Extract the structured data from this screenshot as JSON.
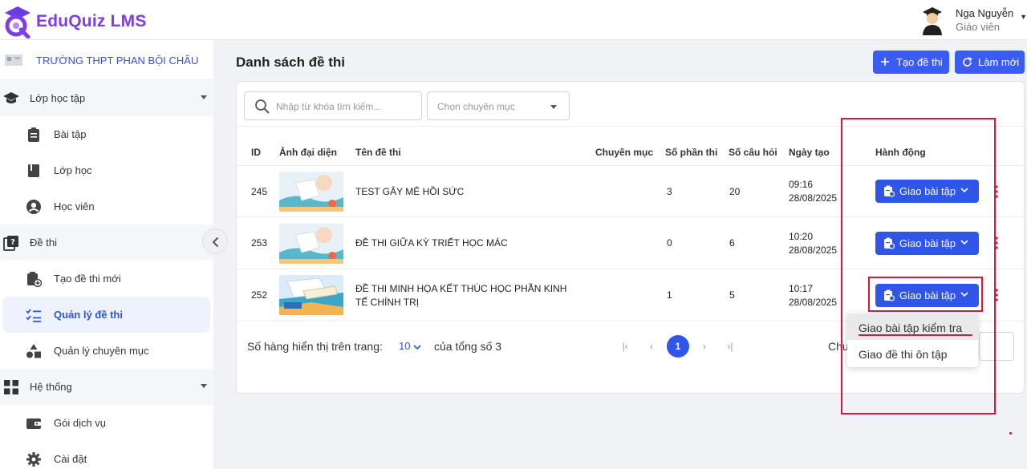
{
  "header": {
    "brand": "EduQuiz LMS",
    "user_name": "Nga Nguyễn",
    "user_role": "Giáo viên"
  },
  "sidebar": {
    "school": "TRƯỜNG THPT PHAN BỘI CHÂU",
    "groups": [
      {
        "label": "Lớp học tập",
        "icon": "graduation-cap-icon",
        "items": [
          {
            "label": "Bài tập",
            "icon": "clipboard-icon"
          },
          {
            "label": "Lớp học",
            "icon": "book-icon"
          },
          {
            "label": "Học viên",
            "icon": "user-circle-icon"
          }
        ]
      },
      {
        "label": "Đề thi",
        "icon": "exam-icon",
        "items": [
          {
            "label": "Tạo đề thi mới",
            "icon": "clipboard-add-icon"
          },
          {
            "label": "Quản lý đề thi",
            "icon": "checklist-icon",
            "active": true
          },
          {
            "label": "Quản lý chuyên mục",
            "icon": "shapes-icon"
          }
        ]
      },
      {
        "label": "Hệ thống",
        "icon": "grid-icon",
        "items": [
          {
            "label": "Gói dịch vụ",
            "icon": "wallet-icon"
          },
          {
            "label": "Cài đặt",
            "icon": "gear-icon"
          }
        ]
      }
    ]
  },
  "main": {
    "title": "Danh sách đề thi",
    "create_button": "Tạo đề thi",
    "refresh_button": "Làm mới",
    "search_placeholder": "Nhập từ khóa tìm kiếm...",
    "category_placeholder": "Chọn chuyên mục",
    "columns": [
      "ID",
      "Ảnh đại diện",
      "Tên đề thi",
      "Chuyên mục",
      "Số phần thi",
      "Số câu hỏi",
      "Ngày tạo",
      "Hành động"
    ],
    "rows": [
      {
        "id": "245",
        "name": "TEST GÂY MÊ HỒI SỨC",
        "name2": "",
        "category": "",
        "parts": "3",
        "questions": "20",
        "time": "09:16",
        "date": "28/08/2025",
        "action": "Giao bài tập"
      },
      {
        "id": "253",
        "name": "ĐỀ THI GIỮA KỲ TRIẾT HỌC MÁC",
        "name2": "",
        "category": "",
        "parts": "0",
        "questions": "6",
        "time": "10:20",
        "date": "28/08/2025",
        "action": "Giao bài tập"
      },
      {
        "id": "252",
        "name": "ĐỀ THI MINH HỌA KẾT THÚC HỌC PHẦN KINH",
        "name2": "TẾ CHÍNH TRỊ",
        "category": "",
        "parts": "1",
        "questions": "5",
        "time": "10:17",
        "date": "28/08/2025",
        "action": "Giao bài tập"
      }
    ],
    "pager": {
      "rows_label": "Số hàng hiển thị trên trang:",
      "rows_value": "10",
      "total_label": "của tổng số 3",
      "current_page": "1",
      "goto_partial": "Chu"
    },
    "dropdown": [
      {
        "label": "Giao bài tập kiểm tra"
      },
      {
        "label": "Giao đề thi ôn tập"
      }
    ]
  },
  "colors": {
    "brand": "#7b3fe4",
    "primary": "#2f55e9",
    "highlight": "#e0143a"
  }
}
